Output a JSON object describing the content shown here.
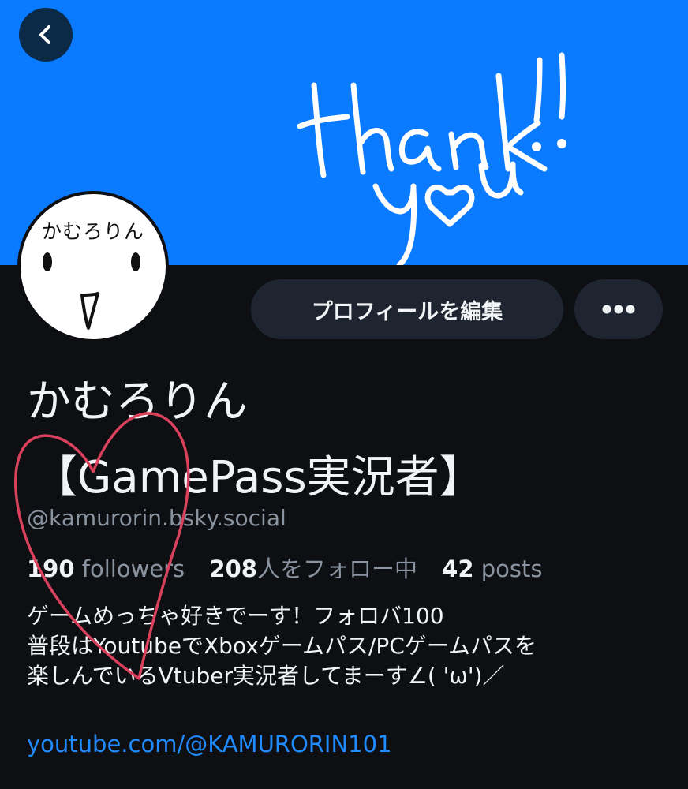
{
  "banner": {
    "handwritten_line1": "thank",
    "handwritten_line2": "you!!",
    "background_color": "#0a7aff"
  },
  "nav": {
    "back_icon": "chevron-left-icon"
  },
  "avatar": {
    "name_text": "かむろりん"
  },
  "actions": {
    "edit_profile_label": "プロフィールを編集",
    "more_icon": "ellipsis-icon"
  },
  "profile": {
    "display_name_line1": "かむろりん",
    "display_name_line2": "【GamePass実況者】",
    "handle": "@kamurorin.bsky.social",
    "followers_count": "190",
    "followers_label": "followers",
    "following_count": "208",
    "following_label": "人をフォロー中",
    "posts_count": "42",
    "posts_label": "posts",
    "bio_lines": [
      "ゲームめっちゃ好きでーす！フォロバ100",
      "普段はYoutubeでXboxゲームパス/PCゲームパスを",
      "楽しんでいるVtuber実況者してまーす∠( 'ω')／"
    ],
    "link": "youtube.com/@KAMURORIN101"
  },
  "colors": {
    "background": "#0d0f12",
    "button_bg": "#1e2530",
    "text_primary": "#f1f3f5",
    "text_secondary": "#8a93a0",
    "link": "#208bfe",
    "heart_doodle": "#d9415c"
  }
}
